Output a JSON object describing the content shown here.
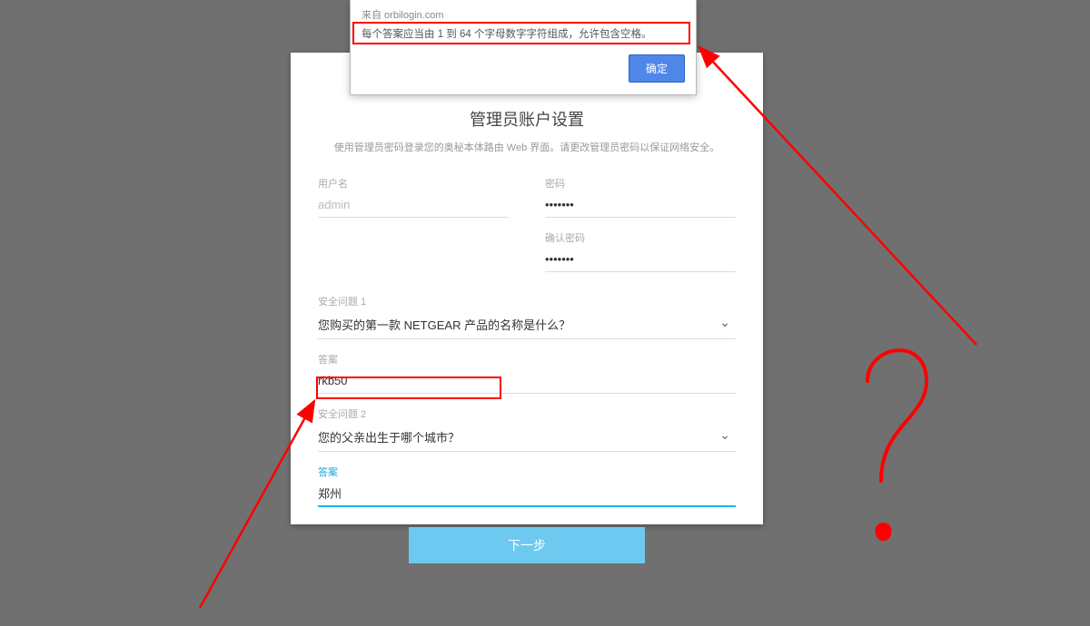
{
  "dialog": {
    "from": "来自 orbilogin.com",
    "message": "每个答案应当由 1 到 64 个字母数字字符组成，允许包含空格。",
    "ok": "确定"
  },
  "card": {
    "title": "管理员账户设置",
    "desc": "使用管理员密码登录您的奥秘本体路由 Web 界面。请更改管理员密码以保证网络安全。",
    "username_label": "用户名",
    "username_value": "admin",
    "password_label": "密码",
    "password_value": "•••••••",
    "confirm_label": "确认密码",
    "confirm_value": "•••••••",
    "q1_label": "安全问题 1",
    "q1_value": "您购买的第一款 NETGEAR 产品的名称是什么？",
    "a1_label": "答案",
    "a1_value": "rkb50",
    "q2_label": "安全问题 2",
    "q2_value": "您的父亲出生于哪个城市？",
    "a2_label": "答案",
    "a2_value": "郑州",
    "next": "下一步"
  }
}
